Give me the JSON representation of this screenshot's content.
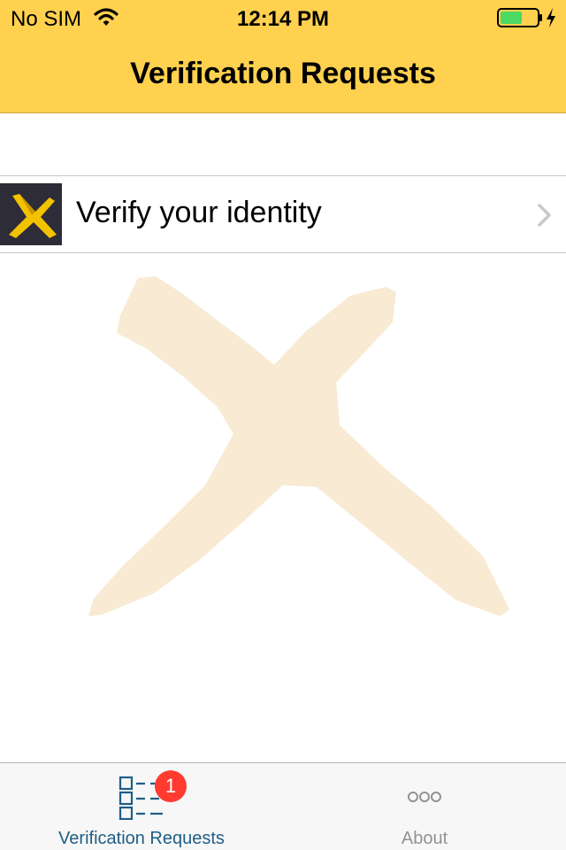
{
  "status_bar": {
    "carrier": "No SIM",
    "time": "12:14 PM",
    "battery_color": "#4cd964"
  },
  "nav": {
    "title": "Verification Requests",
    "background": "#ffd14f"
  },
  "list": {
    "items": [
      {
        "label": "Verify your identity",
        "thumbnail_icon": "x-logo-icon"
      }
    ]
  },
  "watermark": {
    "icon": "x-logo-icon",
    "color": "#f8ead3"
  },
  "tab_bar": {
    "tabs": [
      {
        "label": "Verification Requests",
        "icon": "list-icon",
        "badge": "1",
        "selected": true,
        "color": "#1f5e86"
      },
      {
        "label": "About",
        "icon": "more-icon",
        "selected": false,
        "color": "#929292"
      }
    ]
  }
}
